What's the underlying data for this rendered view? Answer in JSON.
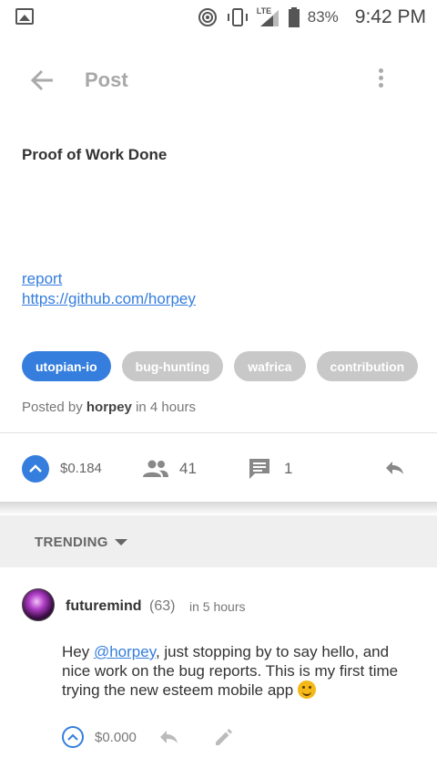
{
  "status_bar": {
    "network_label": "LTE",
    "battery_percent": "83%",
    "time": "9:42 PM"
  },
  "app_bar": {
    "title": "Post"
  },
  "post": {
    "title": "Proof of Work Done",
    "links": [
      {
        "text": "report"
      },
      {
        "text": "https://github.com/horpey"
      }
    ],
    "tags": [
      {
        "label": "utopian-io",
        "active": true
      },
      {
        "label": "bug-hunting",
        "active": false
      },
      {
        "label": "wafrica",
        "active": false
      },
      {
        "label": "contribution",
        "active": false
      }
    ],
    "posted_by_prefix": "Posted by",
    "author": "horpey",
    "time": "in 4 hours",
    "payout": "$0.184",
    "voters": "41",
    "comments": "1"
  },
  "sort": {
    "label": "TRENDING"
  },
  "comment": {
    "author": "futuremind",
    "reputation": "(63)",
    "time": "in 5 hours",
    "body_before": "Hey ",
    "mention": "@horpey",
    "body_after": ",  just stopping by to say hello,  and nice work on the bug reports.  This is my first time trying the new esteem mobile app ",
    "payout": "$0.000"
  },
  "colors": {
    "accent": "#357edd",
    "tag_inactive": "#c8c8c8",
    "trending_bg": "#efefef"
  }
}
